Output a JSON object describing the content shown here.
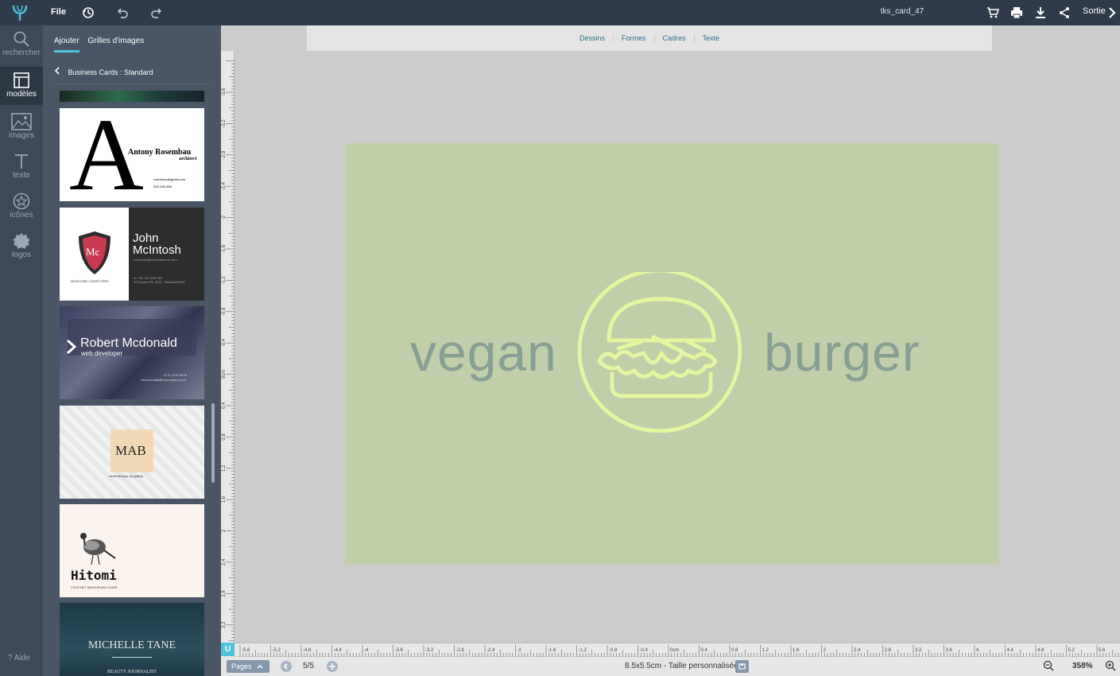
{
  "topbar": {
    "file_label": "File",
    "doc_name": "tks_card_47",
    "exit_label": "Sortie",
    "icons": [
      "history-icon",
      "undo-icon",
      "redo-icon",
      "cart-icon",
      "print-icon",
      "download-icon",
      "share-icon",
      "chevron-right-icon"
    ]
  },
  "rail": {
    "items": [
      {
        "label": "rechercher",
        "icon": "search-icon"
      },
      {
        "label": "modèles",
        "icon": "template-icon"
      },
      {
        "label": "images",
        "icon": "image-icon"
      },
      {
        "label": "texte",
        "icon": "text-icon"
      },
      {
        "label": "icônes",
        "icon": "star-icon"
      },
      {
        "label": "logos",
        "icon": "logo-icon"
      }
    ],
    "help_label": "? Aide"
  },
  "panel": {
    "tabs": [
      {
        "label": "Ajouter"
      },
      {
        "label": "Grilles d'images"
      }
    ],
    "breadcrumb": "Business Cards : Standard",
    "templates": [
      {
        "name": "Antony Rosembau",
        "role": "architect",
        "email": "rosembau@gmail.com",
        "phone": "042-236-458",
        "big_letter": "A"
      },
      {
        "first": "John",
        "last": "McIntosh",
        "email": "j.mcintosh@mccomputers.com",
        "company": "MCINTOSH COMPUTERS",
        "badge": "Mc",
        "phone": "m. +61 123 456 789",
        "address": "123 Queen St. 4012 - Brisbane/AUS"
      },
      {
        "name": "Robert Mcdonald",
        "role": "web.developer",
        "phone": "+1 11 1234 5678",
        "email": "robmcdonald@mycompany.com"
      },
      {
        "name": "MAB",
        "tagline": "contemporary art gallery"
      },
      {
        "name": "Hitomi",
        "tagline": "CROCHET AMIGURUMI LOVER"
      },
      {
        "name": "MICHELLE TANE",
        "role": "BEAUTY JOURNALIST"
      }
    ]
  },
  "toolbar": {
    "tools": [
      "Dessins",
      "Formes",
      "Cadres",
      "Texte"
    ]
  },
  "ruler": {
    "vertical_labels": [
      "-3.6",
      "-3.2",
      "-2.8",
      "-2.4",
      "-2",
      "-1.6",
      "-1.2",
      "-0.8",
      "-0.4",
      "0cm",
      "0.4",
      "0.8",
      "1.2",
      "1.6",
      "2",
      "2.4",
      "2.8",
      "3.2",
      "3.6"
    ],
    "horizontal_labels": [
      "-5.6",
      "-5.2",
      "-4.8",
      "-4.4",
      "-4",
      "-3.6",
      "-3.2",
      "-2.8",
      "-2.4",
      "-2",
      "-1.6",
      "-1.2",
      "-0.8",
      "-0.4",
      "0cm",
      "0.4",
      "0.8",
      "1.2",
      "1.6",
      "2",
      "2.4",
      "2.8",
      "3.2",
      "3.6",
      "4",
      "4.4",
      "4.8",
      "5.2",
      "5.6"
    ],
    "corner_label": "U"
  },
  "card": {
    "word_left": "vegan",
    "word_right": "burger",
    "background": "#c1ceaa",
    "text_color": "#87a091",
    "emblem_color": "#e2f7a0"
  },
  "bottombar": {
    "pages_label": "Pages",
    "page_count": "5/5",
    "size_label": "8.5x5.5cm - Taille personnalisée",
    "zoom": "358%"
  },
  "colors": {
    "topbar": "#2f3b4a",
    "accent": "#4fc3d8"
  }
}
